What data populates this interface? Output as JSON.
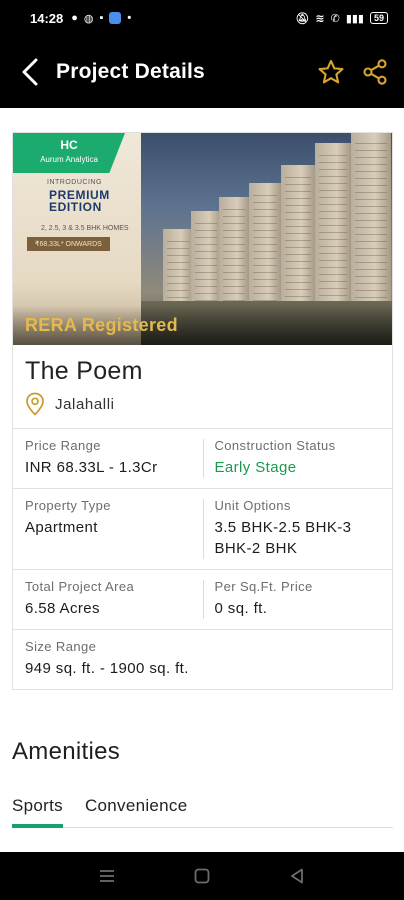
{
  "status_bar": {
    "time": "14:28",
    "battery": "59"
  },
  "app_bar": {
    "title": "Project Details"
  },
  "hero": {
    "ribbon_title": "HC",
    "ribbon_subtitle": "Aurum Analytica",
    "brochure_intro": "INTRODUCING",
    "brochure_headline": "PREMIUM EDITION",
    "brochure_homes": "2, 2.5, 3 & 3.5 BHK HOMES",
    "brochure_price": "₹68.33L* ONWARDS",
    "rera_label": "RERA Registered"
  },
  "project": {
    "name": "The Poem",
    "location": "Jalahalli"
  },
  "details": [
    {
      "label": "Price Range",
      "value": "INR 68.33L - 1.3Cr",
      "highlight": false
    },
    {
      "label": "Construction Status",
      "value": "Early Stage",
      "highlight": true
    },
    {
      "label": "Property Type",
      "value": "Apartment",
      "highlight": false
    },
    {
      "label": "Unit Options",
      "value": "3.5 BHK-2.5 BHK-3 BHK-2 BHK",
      "highlight": false
    },
    {
      "label": "Total Project Area",
      "value": "6.58 Acres",
      "highlight": false
    },
    {
      "label": "Per Sq.Ft. Price",
      "value": "0 sq. ft.",
      "highlight": false
    },
    {
      "label": "Size Range",
      "value": "949 sq. ft. - 1900 sq. ft.",
      "highlight": false
    }
  ],
  "amenities": {
    "title": "Amenities",
    "tabs": [
      {
        "label": "Sports",
        "active": true
      },
      {
        "label": "Convenience",
        "active": false
      }
    ]
  },
  "colors": {
    "accent_green": "#16a06a",
    "gold": "#e6b94e",
    "status_green": "#1a9a4f"
  },
  "icons": {
    "back": "arrow-left-icon",
    "favorite": "star-outline-icon",
    "share": "share-icon",
    "location": "location-pin-icon",
    "nav_menu": "menu-icon",
    "nav_home": "home-square-icon",
    "nav_back": "triangle-back-icon"
  }
}
